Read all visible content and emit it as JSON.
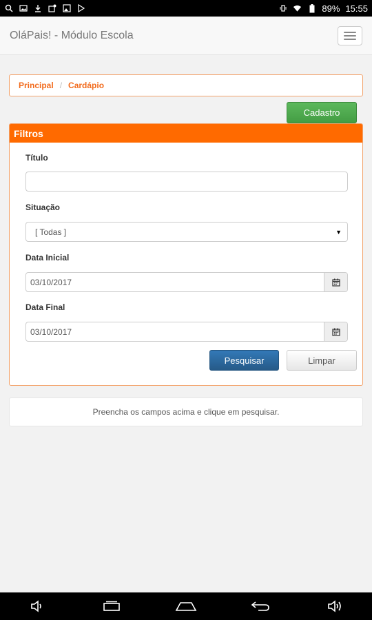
{
  "status_bar": {
    "battery": "89%",
    "time": "15:55",
    "left_icons": [
      "search-icon",
      "image-icon",
      "download-icon",
      "photo-settings-icon",
      "gallery-icon",
      "play-store-icon"
    ],
    "right_icons": [
      "vibrate-icon",
      "wifi-icon",
      "battery-icon"
    ]
  },
  "header": {
    "title": "OláPais! - Módulo Escola",
    "menu_icon": "hamburger-icon"
  },
  "breadcrumb": {
    "items": [
      "Principal",
      "Cardápio"
    ],
    "separator": "/"
  },
  "actions": {
    "cadastro": "Cadastro"
  },
  "filters": {
    "heading": "Filtros",
    "titulo_label": "Título",
    "titulo_value": "",
    "situacao_label": "Situação",
    "situacao_value": "[ Todas ]",
    "data_inicial_label": "Data Inicial",
    "data_inicial_value": "03/10/2017",
    "data_final_label": "Data Final",
    "data_final_value": "03/10/2017",
    "calendar_icon": "calendar-icon",
    "search_button": "Pesquisar",
    "clear_button": "Limpar"
  },
  "message": "Preencha os campos acima e clique em pesquisar.",
  "nav_bar": {
    "icons": [
      "volume-down-icon",
      "recent-apps-icon",
      "home-icon",
      "back-icon",
      "volume-up-icon"
    ]
  },
  "colors": {
    "accent": "#ff6a00",
    "success": "#5cb85c",
    "primary": "#337ab7"
  }
}
